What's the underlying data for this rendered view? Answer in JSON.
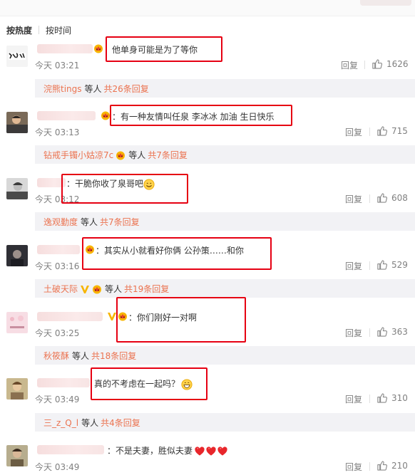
{
  "sort": {
    "hot_label": "按热度",
    "time_label": "按时间"
  },
  "comments": [
    {
      "text": "他单身可能是为了等你",
      "time": "今天 03:21",
      "reply_label": "回复",
      "likes": "1626",
      "replies": {
        "user": "浣熊tings",
        "mid": "等人",
        "count": "共26条回复"
      }
    },
    {
      "text": "：有一种友情叫任泉 李冰冰 加油 生日快乐",
      "time": "今天 03:13",
      "reply_label": "回复",
      "likes": "715",
      "replies": {
        "user": "钻戒手镯小姑凉7c",
        "mid": "等人",
        "count": "共7条回复"
      }
    },
    {
      "text": "：干脆你收了泉哥吧",
      "time": "今天 03:12",
      "reply_label": "回复",
      "likes": "608",
      "replies": {
        "user": "逸观勤度",
        "mid": "等人",
        "count": "共7条回复"
      }
    },
    {
      "text": "：其实从小就看好你俩 公孙策……和你",
      "time": "今天 03:16",
      "reply_label": "回复",
      "likes": "529",
      "replies": {
        "user": "土破天际",
        "mid": "等人",
        "count": "共19条回复"
      }
    },
    {
      "text": "：你们刚好一对啊",
      "time": "今天 03:25",
      "reply_label": "回复",
      "likes": "363",
      "replies": {
        "user": "秋筱酥",
        "mid": "等人",
        "count": "共18条回复"
      }
    },
    {
      "text": "真的不考虑在一起吗？",
      "time": "今天 03:49",
      "reply_label": "回复",
      "likes": "310",
      "replies": {
        "user": "三_z_Q_l",
        "mid": "等人",
        "count": "共4条回复"
      }
    },
    {
      "text": "：不是夫妻，胜似夫妻",
      "time": "今天 03:49",
      "reply_label": "回复",
      "likes": "210"
    }
  ],
  "colors": {
    "link_orange": "#eb7350",
    "highlight_red": "#e60012",
    "meta_gray": "#808080",
    "reply_bg": "#f2f2f5"
  },
  "icons": {
    "like": "thumbs-up-icon",
    "vip": "vip-crown-icon",
    "v_badge": "verified-v-icon",
    "smile": "smile-emoji-icon",
    "heart": "heart-emoji-icon"
  }
}
